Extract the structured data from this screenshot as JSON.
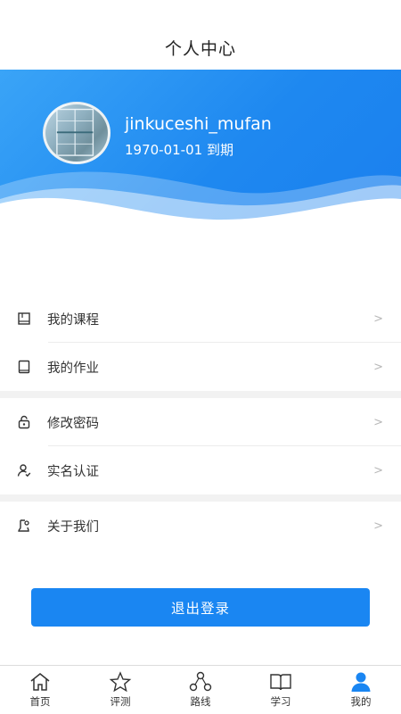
{
  "header": {
    "title": "个人中心"
  },
  "profile": {
    "username": "jinkuceshi_mufan",
    "expiry": "1970-01-01 到期"
  },
  "menu": {
    "group1": [
      {
        "label": "我的课程",
        "icon": "course-book-icon",
        "chevron": ">"
      },
      {
        "label": "我的作业",
        "icon": "homework-notebook-icon",
        "chevron": ">"
      }
    ],
    "group2": [
      {
        "label": "修改密码",
        "icon": "lock-icon",
        "chevron": ">"
      },
      {
        "label": "实名认证",
        "icon": "user-verify-icon",
        "chevron": ">"
      }
    ],
    "group3": [
      {
        "label": "关于我们",
        "icon": "about-icon",
        "chevron": ">"
      }
    ]
  },
  "logout_label": "退出登录",
  "tabbar": [
    {
      "label": "首页",
      "icon": "home-icon"
    },
    {
      "label": "评测",
      "icon": "star-icon"
    },
    {
      "label": "路线",
      "icon": "route-icon"
    },
    {
      "label": "学习",
      "icon": "open-book-icon"
    },
    {
      "label": "我的",
      "icon": "user-icon",
      "active": true
    }
  ],
  "colors": {
    "accent": "#1a86f2",
    "banner_start": "#3aa4f7",
    "banner_end": "#1a7fee"
  }
}
